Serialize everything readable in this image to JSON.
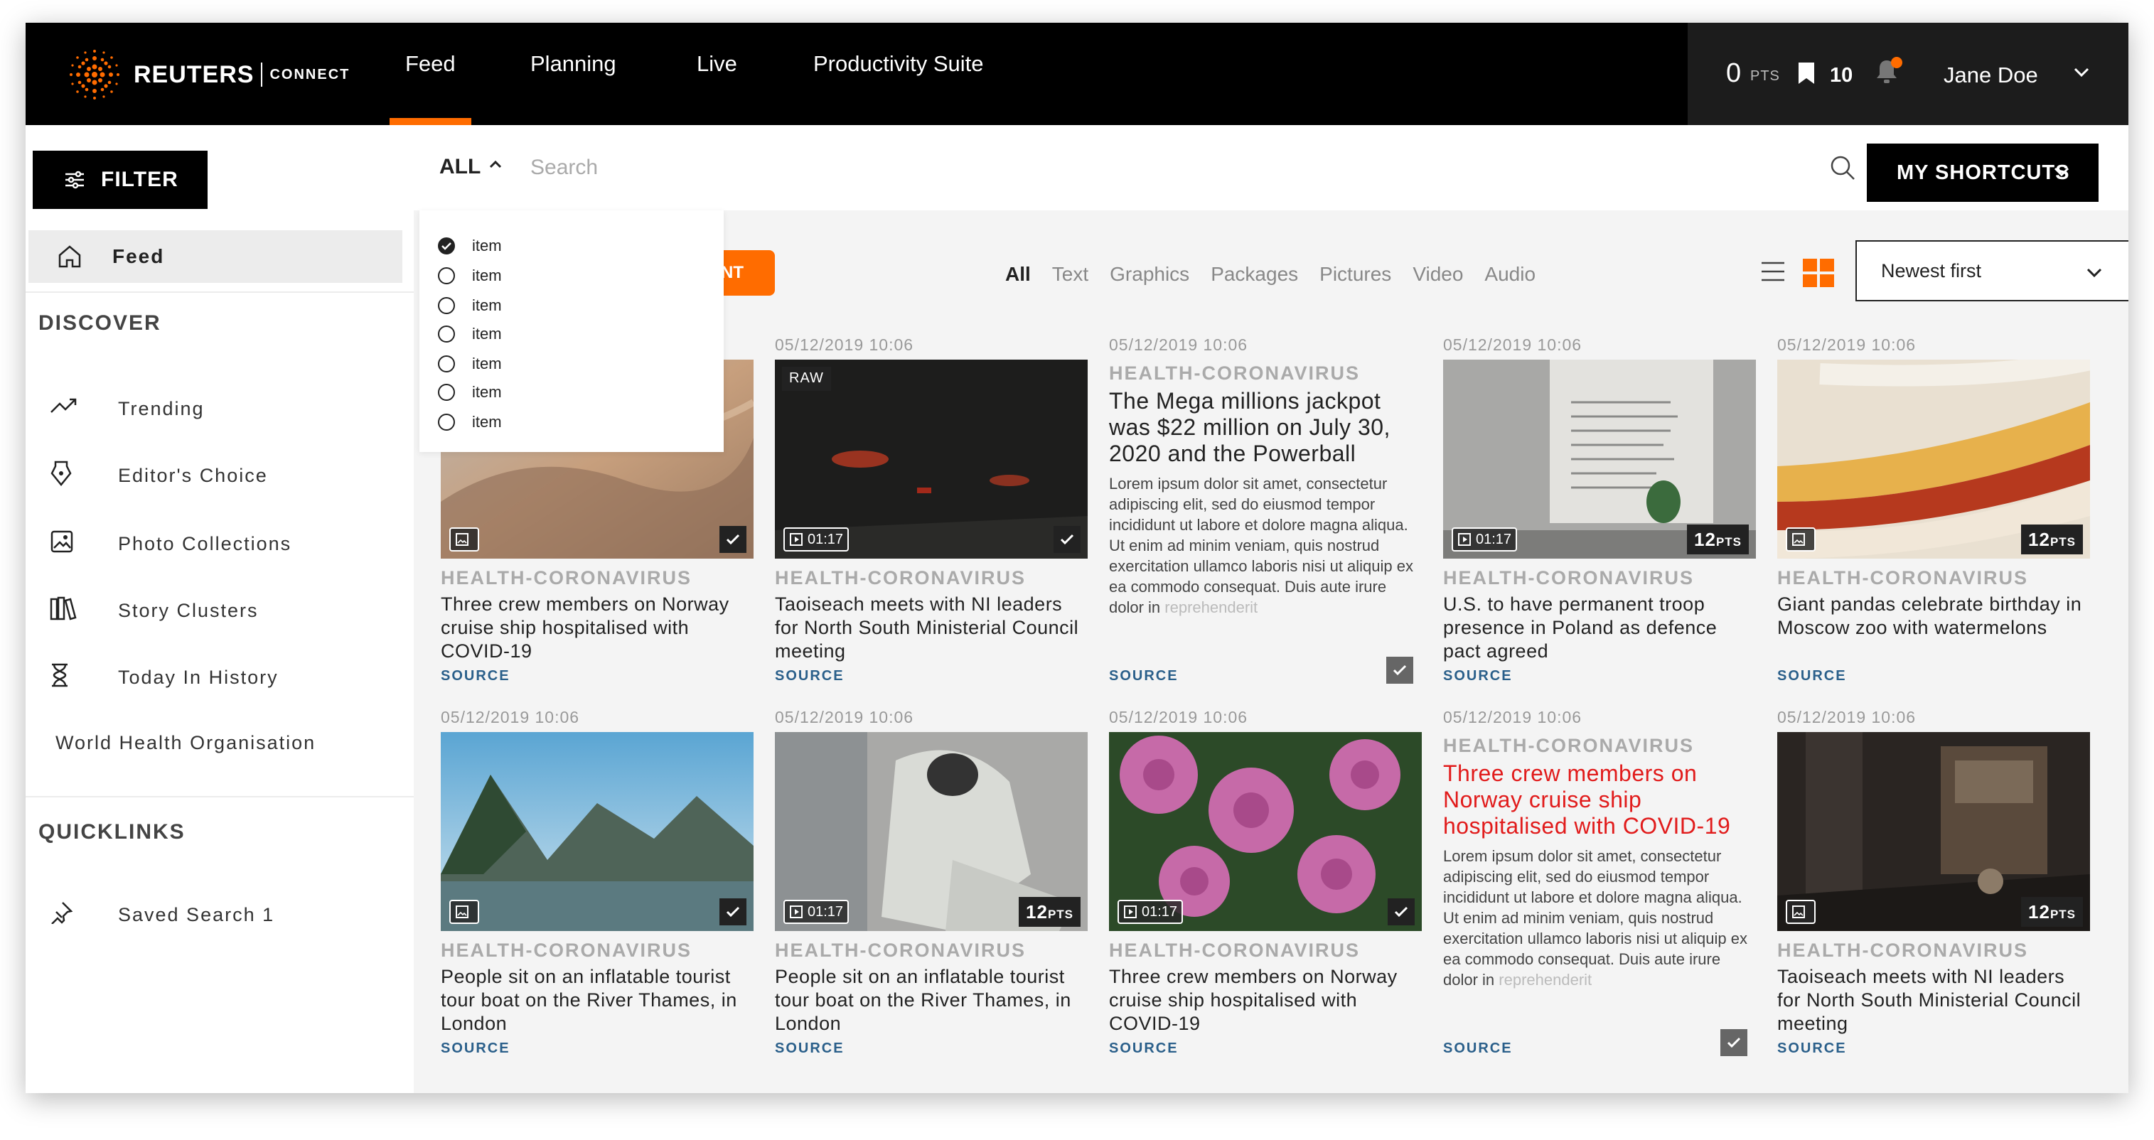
{
  "header": {
    "brand": "REUTERS",
    "brand_sub": "CONNECT",
    "nav": [
      "Feed",
      "Planning",
      "Live",
      "Productivity Suite"
    ],
    "points": "0",
    "points_label": "PTS",
    "bookmarks": "10",
    "user": "Jane Doe"
  },
  "sidebar": {
    "filter_label": "FILTER",
    "feed_label": "Feed",
    "discover_heading": "DISCOVER",
    "discover_items": [
      "Trending",
      "Editor's Choice",
      "Photo Collections",
      "Story Clusters",
      "Today In History"
    ],
    "extra_item": "World Health Organisation",
    "quicklinks_heading": "QUICKLINKS",
    "quicklinks": [
      "Saved Search 1"
    ]
  },
  "search": {
    "scope": "ALL",
    "placeholder": "Search",
    "shortcuts_label": "MY SHORTCUTS",
    "dropdown_items": [
      "item",
      "item",
      "item",
      "item",
      "item",
      "item",
      "item"
    ],
    "dropdown_selected_index": 0,
    "orange_button_label": "NT"
  },
  "filters": {
    "types": [
      "All",
      "Text",
      "Graphics",
      "Packages",
      "Pictures",
      "Video",
      "Audio"
    ],
    "active_type": "All",
    "sort": "Newest first"
  },
  "colors": {
    "accent": "#ff6c00",
    "source": "#2a5f8a",
    "highlight": "#e11b1b"
  },
  "cards": [
    {
      "date": "",
      "category": "HEALTH-CORONAVIRUS",
      "title": "Three crew members on Norway cruise ship hospitalised with COVID-19",
      "source": "SOURCE",
      "media": "picture",
      "badge": "check"
    },
    {
      "date": "05/12/2019 10:06",
      "category": "HEALTH-CORONAVIRUS",
      "title": "Taoiseach meets with NI leaders for North South Ministerial Council meeting",
      "source": "SOURCE",
      "media": "video",
      "duration": "01:17",
      "raw": "RAW",
      "badge": "check"
    },
    {
      "date": "05/12/2019 10:06",
      "category": "HEALTH-CORONAVIRUS",
      "title": "The Mega millions jackpot was $22 million on July 30, 2020 and the Powerball",
      "body": "Lorem ipsum dolor sit amet, consectetur adipiscing elit, sed do eiusmod tempor incididunt ut labore et dolore magna aliqua. Ut enim ad minim veniam, quis nostrud exercitation ullamco laboris nisi ut aliquip ex ea commodo consequat. Duis aute irure dolor in",
      "body_fade": "reprehenderit",
      "source": "SOURCE",
      "media": "text"
    },
    {
      "date": "05/12/2019 10:06",
      "category": "HEALTH-CORONAVIRUS",
      "title": "U.S. to have permanent troop presence in Poland as defence pact agreed",
      "source": "SOURCE",
      "media": "video",
      "duration": "01:17",
      "badge": "pts",
      "pts": "12"
    },
    {
      "date": "05/12/2019 10:06",
      "category": "HEALTH-CORONAVIRUS",
      "title": "Giant pandas celebrate birthday in Moscow zoo with watermelons",
      "source": "SOURCE",
      "media": "picture",
      "badge": "pts",
      "pts": "12"
    },
    {
      "date": "05/12/2019 10:06",
      "category": "HEALTH-CORONAVIRUS",
      "title": "People sit on an inflatable tourist tour boat on the River Thames, in London",
      "source": "SOURCE",
      "media": "picture",
      "badge": "check"
    },
    {
      "date": "05/12/2019 10:06",
      "category": "HEALTH-CORONAVIRUS",
      "title": "People sit on an inflatable tourist tour boat on the River Thames, in London",
      "source": "SOURCE",
      "media": "video",
      "duration": "01:17",
      "badge": "pts",
      "pts": "12"
    },
    {
      "date": "05/12/2019 10:06",
      "category": "HEALTH-CORONAVIRUS",
      "title": "Three crew members on Norway cruise ship hospitalised with COVID-19",
      "source": "SOURCE",
      "media": "video",
      "duration": "01:17",
      "badge": "check"
    },
    {
      "date": "05/12/2019 10:06",
      "category": "HEALTH-CORONAVIRUS",
      "title": "Three crew members on Norway cruise ship hospitalised with COVID-19",
      "body": "Lorem ipsum dolor sit amet, consectetur adipiscing elit, sed do eiusmod tempor incididunt ut labore et dolore magna aliqua. Ut enim ad minim veniam, quis nostrud exercitation ullamco laboris nisi ut aliquip ex ea commodo consequat. Duis aute irure dolor in",
      "body_fade": "reprehenderit",
      "source": "SOURCE",
      "media": "text"
    },
    {
      "date": "05/12/2019 10:06",
      "category": "HEALTH-CORONAVIRUS",
      "title": "Taoiseach meets with NI leaders for North South Ministerial Council meeting",
      "source": "SOURCE",
      "media": "picture",
      "badge": "pts",
      "pts": "12"
    }
  ],
  "pts_suffix": "PTS"
}
